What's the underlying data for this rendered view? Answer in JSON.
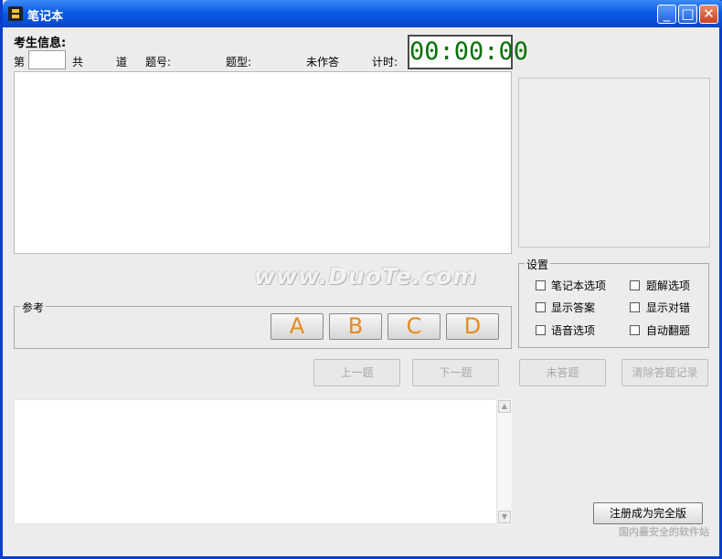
{
  "window": {
    "title": "笔记本",
    "minimize": "_",
    "maximize": "□",
    "close": "✕"
  },
  "exam_info": {
    "heading": "考生信息:",
    "prefix_label": "第",
    "current_value": "",
    "total_label": "共",
    "unit_label": "道",
    "qno_label": "题号:",
    "qtype_label": "题型:",
    "unanswered_label": "未作答",
    "timer_label": "计时:",
    "timer_value": "00:00:00"
  },
  "reference": {
    "label": "参考",
    "options": [
      "A",
      "B",
      "C",
      "D"
    ]
  },
  "navigation": {
    "prev_label": "上一题",
    "next_label": "下一题",
    "unanswered_label": "未答题",
    "clear_label": "清除答题记录"
  },
  "settings": {
    "title": "设置",
    "items": [
      {
        "label": "笔记本选项",
        "checked": false
      },
      {
        "label": "题解选项",
        "checked": false
      },
      {
        "label": "显示答案",
        "checked": false
      },
      {
        "label": "显示对错",
        "checked": false
      },
      {
        "label": "语音选项",
        "checked": false
      },
      {
        "label": "自动翻题",
        "checked": false
      }
    ]
  },
  "register_label": "注册成为完全版",
  "watermark_text": "www.DuoTe.com",
  "corner_logo_text": "国内最安全的软件站",
  "colors": {
    "titlebar": "#0a5ce6",
    "timer_text": "#067106",
    "answer_letters": "#e58b1e"
  }
}
